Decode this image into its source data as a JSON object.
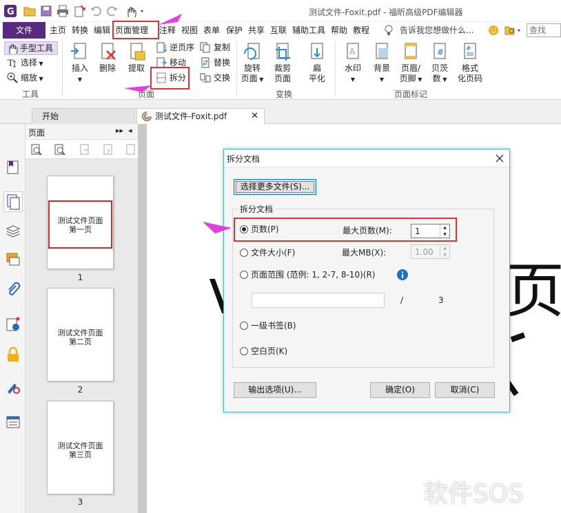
{
  "window": {
    "title": "测试文件-Foxit.pdf - 福昕高级PDF编辑器"
  },
  "menubar": {
    "file": "文件",
    "items": [
      "主页",
      "转换",
      "编辑",
      "页面管理",
      "注释",
      "视图",
      "表单",
      "保护",
      "共享",
      "互联",
      "辅助工具",
      "帮助",
      "教程"
    ],
    "tell_me": "告诉我您想做什么...",
    "search_placeholder": "查找"
  },
  "ribbon": {
    "tools": {
      "hand": "手型工具",
      "select": "选择",
      "zoom": "缩放",
      "group": "工具"
    },
    "pages": {
      "insert": "插入",
      "delete": "删除",
      "extract": "提取",
      "reverse": "逆页序",
      "move": "移动",
      "split": "拆分",
      "copy": "复制",
      "replace": "替换",
      "swap": "交换",
      "group": "页面"
    },
    "transform": {
      "rotate": "旋转\n页面",
      "crop": "裁剪\n页面",
      "flatten": "扁\n平化",
      "group": "变换"
    },
    "marks": {
      "watermark": "水印",
      "background": "背景",
      "header_footer": "页眉/\n页脚",
      "bates": "贝茨\n数",
      "format_page": "格式\n化页码",
      "group": "页面标记"
    }
  },
  "tabs": [
    {
      "label": "开始"
    },
    {
      "label": "测试文件-Foxit.pdf"
    }
  ],
  "pages_panel": {
    "title": "页面",
    "thumbs": [
      {
        "text": "测试文件页面\n第一页",
        "number": "1"
      },
      {
        "text": "测试文件页面\n第二页",
        "number": "2"
      },
      {
        "text": "测试文件页面\n第三页",
        "number": "3"
      }
    ]
  },
  "document": {
    "visible_char": "页"
  },
  "dialog": {
    "title": "拆分文档",
    "select_more": "选择更多文件(S)...",
    "group_label": "拆分文档",
    "options": {
      "pages": "页数(P)",
      "file_size": "文件大小(F)",
      "page_range": "页面范围 (范例: 1, 2-7, 8-10)(R)",
      "bookmark": "一级书签(B)",
      "blank_page": "空白页(K)"
    },
    "max_pages_label": "最大页数(M):",
    "max_pages_value": "1",
    "max_mb_label": "最大MB(X):",
    "max_mb_value": "1.00",
    "range_separator": "/",
    "range_total": "3",
    "output_options": "输出选项(U)...",
    "ok": "确定(O)",
    "cancel": "取消(C)"
  },
  "watermark": "软件SOS",
  "colors": {
    "accent": "#5a2a82",
    "highlight": "#d33333",
    "arrow": "#e040e0",
    "dialog_border": "#4ab0c8"
  }
}
